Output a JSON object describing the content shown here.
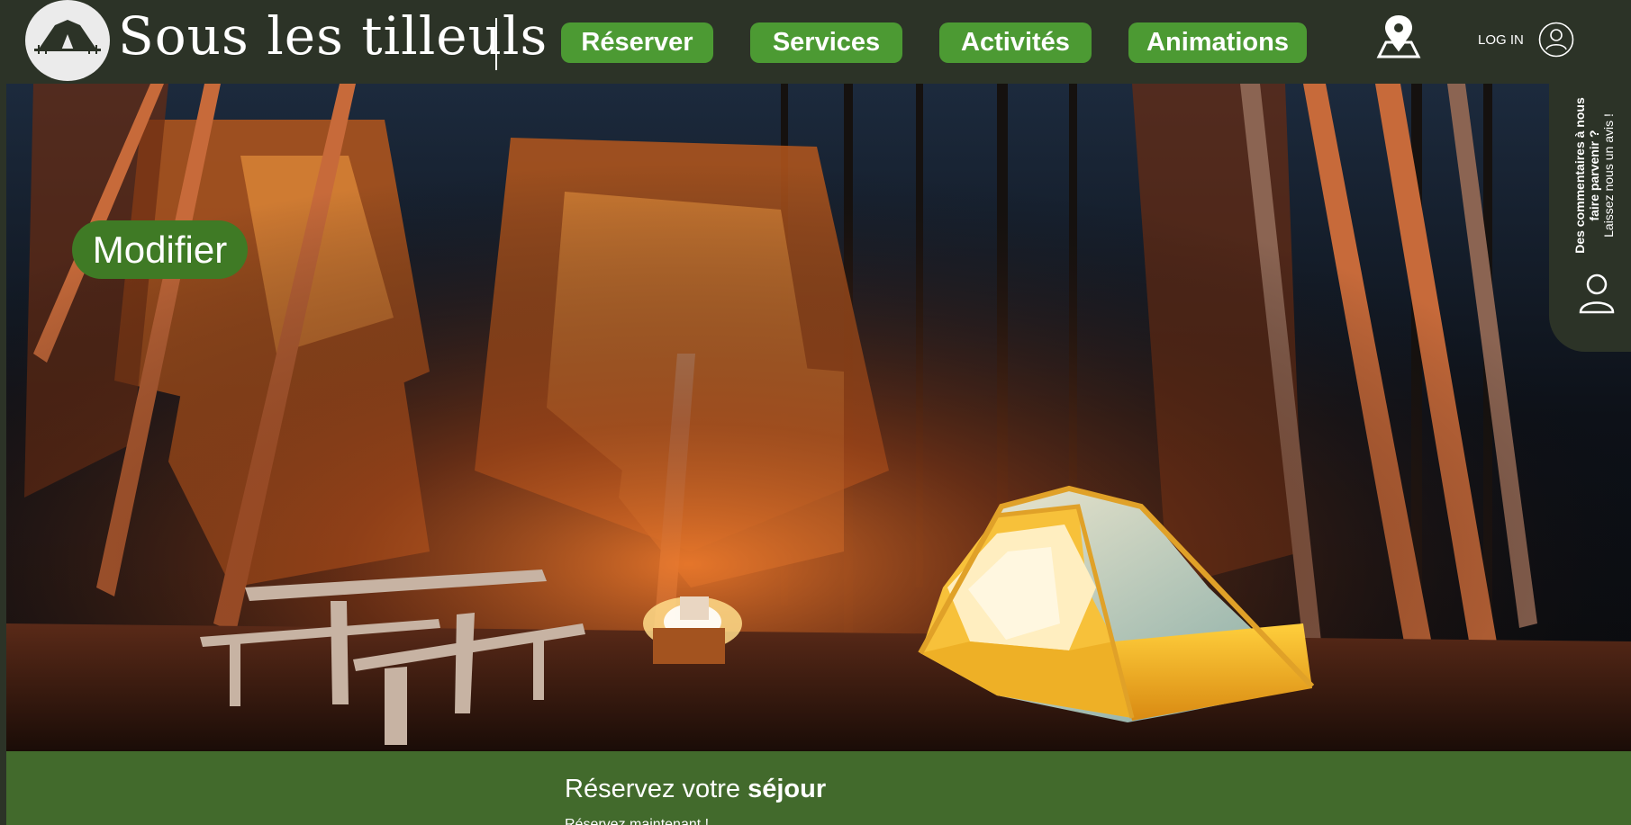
{
  "header": {
    "site_title": "Sous les tilleuls",
    "logo_icon": "tent-logo-icon",
    "nav": [
      {
        "label": "Réserver"
      },
      {
        "label": "Services"
      },
      {
        "label": "Activités"
      },
      {
        "label": "Animations"
      }
    ],
    "map_icon": "map-pin-icon",
    "login_label": "LOG IN",
    "login_icon": "user-circle-icon"
  },
  "hero": {
    "modifier_label": "Modifier",
    "carousel": {
      "count": 3,
      "active_index": 0
    }
  },
  "feedback": {
    "title": "Des commentaires à nous faire parvenir ?",
    "subtitle": "Laissez nous un avis !",
    "icon": "user-icon"
  },
  "booking": {
    "title_prefix": "Réservez votre ",
    "title_emphasis": "séjour",
    "subtitle": "Réservez maintenant !"
  },
  "colors": {
    "header_bg": "#2c3327",
    "nav_button": "#4c9a33",
    "modifier_button": "#3f7a25",
    "booking_bg": "#426a2c",
    "active_dot": "#3fd413",
    "inactive_dot": "#d9d9d9"
  }
}
